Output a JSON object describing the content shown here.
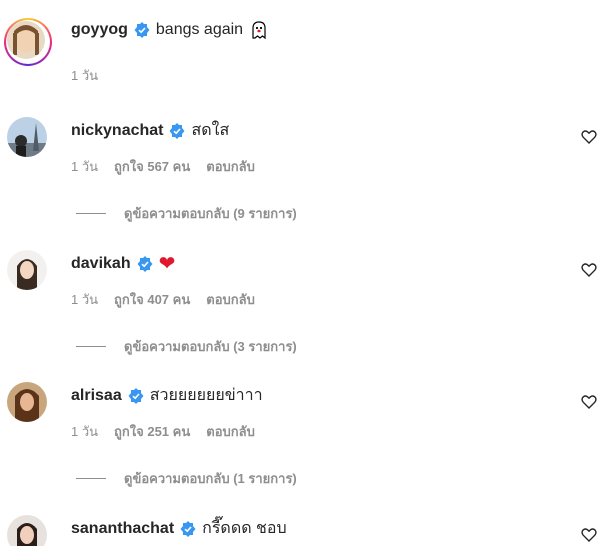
{
  "caption": {
    "username": "goyyog",
    "text": "bangs again",
    "emoji": "ghost-emoji",
    "time": "1 วัน"
  },
  "comments": [
    {
      "username": "nickynachat",
      "text": "สดใส",
      "time": "1 วัน",
      "likes": "ถูกใจ 567 คน",
      "reply": "ตอบกลับ",
      "view_replies": "ดูข้อความตอบกลับ (9 รายการ)"
    },
    {
      "username": "davikah",
      "text": "❤",
      "time": "1 วัน",
      "likes": "ถูกใจ 407 คน",
      "reply": "ตอบกลับ",
      "view_replies": "ดูข้อความตอบกลับ (3 รายการ)"
    },
    {
      "username": "alrisaa",
      "text": "สวยยยยยยข่าาา",
      "time": "1 วัน",
      "likes": "ถูกใจ 251 คน",
      "reply": "ตอบกลับ",
      "view_replies": "ดูข้อความตอบกลับ (1 รายการ)"
    },
    {
      "username": "sananthachat",
      "text": "กรี๊ดดด ชอบ"
    }
  ],
  "colors": {
    "verified": "#3897f0",
    "muted": "#8e8e8e",
    "heart_emoji": "#e0182d"
  }
}
